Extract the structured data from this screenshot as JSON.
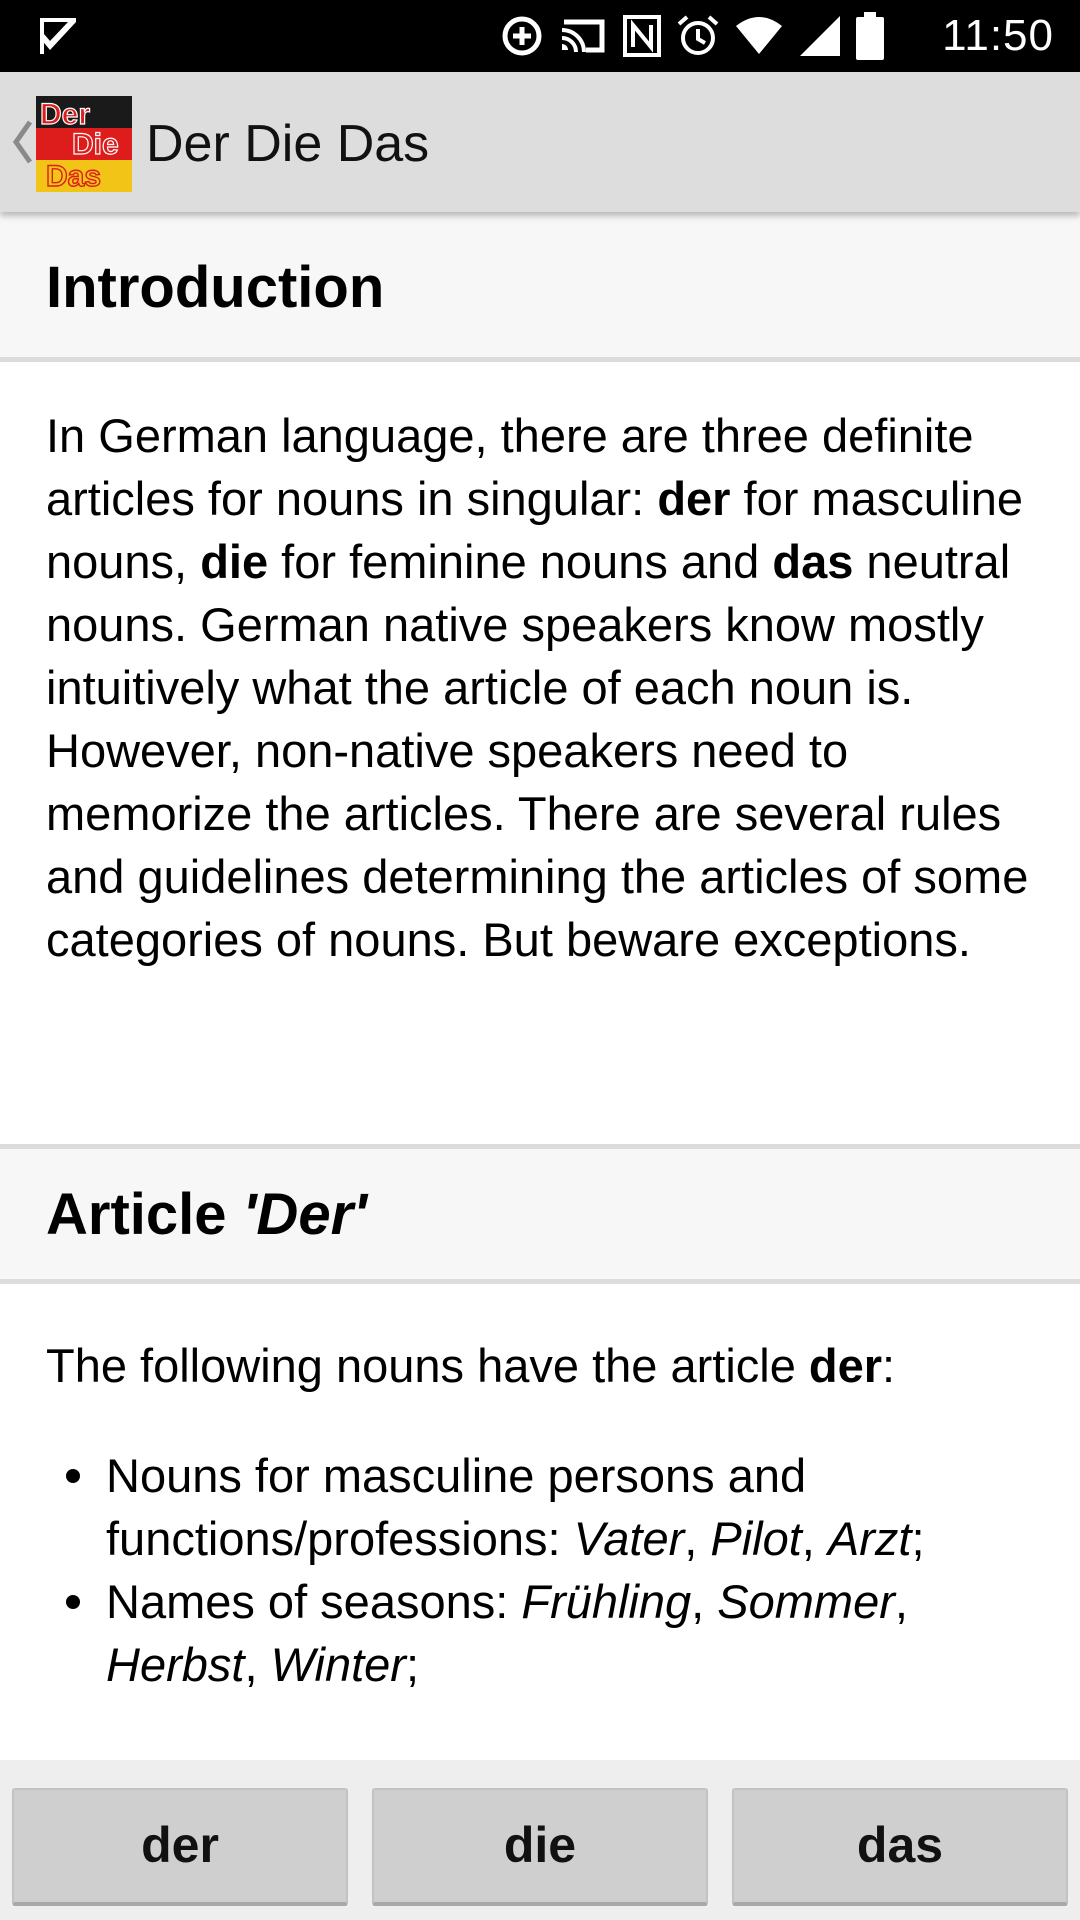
{
  "status_bar": {
    "time": "11:50",
    "icons": [
      "notification-check-icon",
      "data-saver-icon",
      "cast-icon",
      "nfc-icon",
      "alarm-icon",
      "wifi-icon",
      "signal-icon",
      "battery-icon"
    ]
  },
  "app_bar": {
    "title": "Der Die Das",
    "logo_words": [
      "Der",
      "Die",
      "Das"
    ]
  },
  "sections": {
    "introduction": {
      "title": "Introduction",
      "text": {
        "t1": "In German language, there are three definite articles for nouns in singular: ",
        "b1": "der",
        "t2": " for masculine nouns, ",
        "b2": "die",
        "t3": " for feminine nouns and ",
        "b3": "das",
        "t4": " neutral nouns. German native speakers know mostly intuitively what the article of each noun is. However, non-native speakers need to memorize the articles. There are several rules and guidelines determining the articles of some categories of nouns. But beware exceptions."
      }
    },
    "article_der": {
      "title_prefix": "Article ",
      "title_word": "'Der'",
      "intro": {
        "t1": "The following nouns have the article ",
        "b1": "der",
        "t2": ":"
      },
      "rules": [
        {
          "text": "Nouns for masculine persons and functions/professions: ",
          "examples": [
            "Vater",
            "Pilot",
            "Arzt"
          ]
        },
        {
          "text": "Names of seasons: ",
          "examples": [
            "Frühling",
            "Sommer",
            "Herbst",
            "Winter"
          ]
        }
      ]
    }
  },
  "bottom_buttons": {
    "der": "der",
    "die": "die",
    "das": "das"
  }
}
